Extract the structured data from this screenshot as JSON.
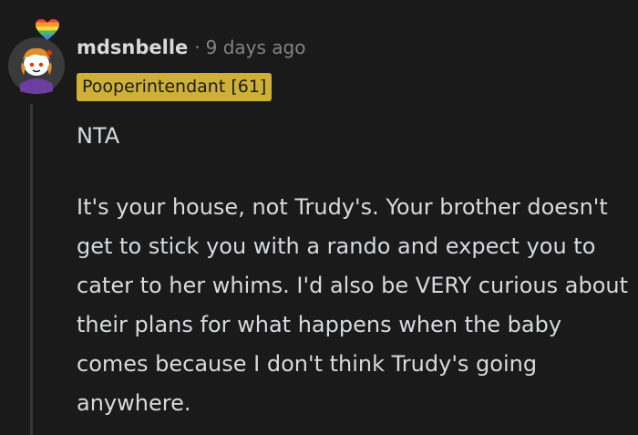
{
  "comment": {
    "username": "mdsnbelle",
    "separator": "·",
    "timestamp": "9 days ago",
    "flair": "Pooperintendant [61]",
    "paragraphs": [
      "NTA",
      "It's your house, not Trudy's. Your brother doesn't get to stick you with a rando and expect you to cater to her whims. I'd also be VERY curious about their plans for what happens when the baby comes because I don't think Trudy's going anywhere."
    ],
    "avatar_icon": "avatar-icon",
    "badge_icon": "rainbow-heart-icon"
  },
  "colors": {
    "background": "#1a1a1b",
    "text": "#d7dadc",
    "muted": "#818384",
    "flair_background": "#ceb036",
    "thread_line": "#343536"
  }
}
